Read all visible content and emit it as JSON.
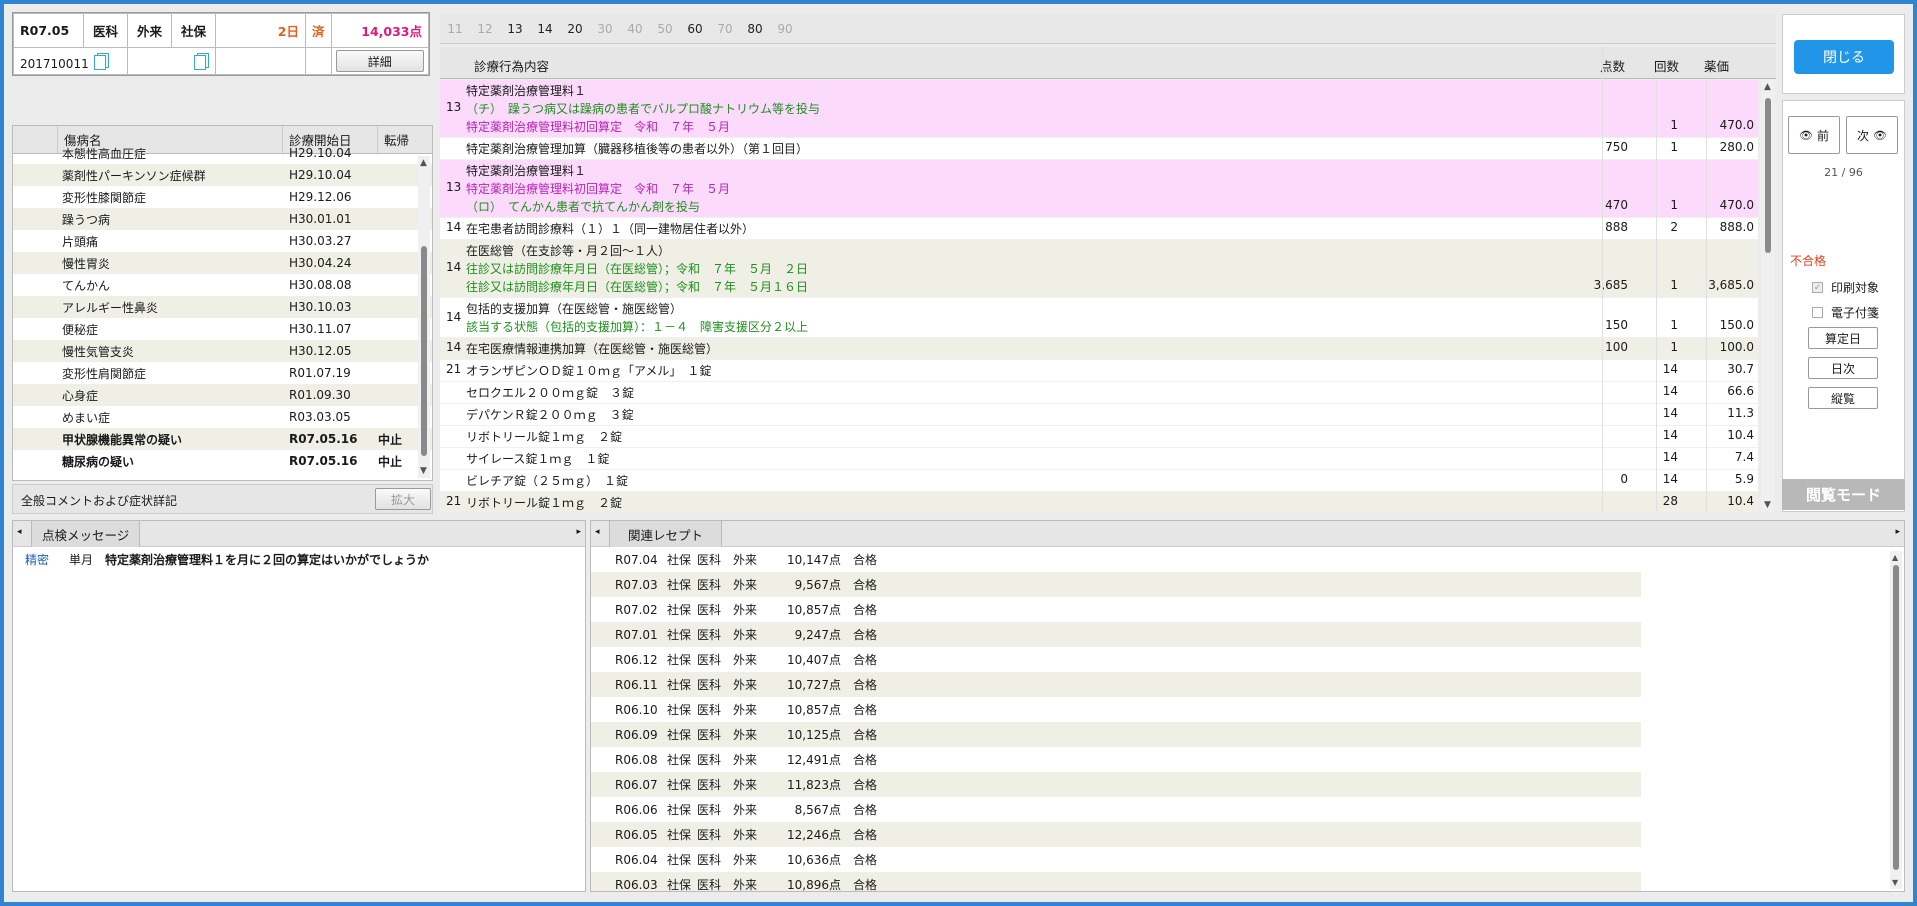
{
  "header": {
    "date": "R07.05",
    "dept": "医科",
    "visit": "外来",
    "insurance": "社保",
    "days": "2日",
    "done": "済",
    "points": "14,033点",
    "patient_id": "201710011",
    "detail_btn": "詳細"
  },
  "disease": {
    "headers": [
      "傷病名",
      "診療開始日",
      "転帰"
    ],
    "rows": [
      {
        "name": "本態性高血圧症",
        "date": "H29.10.04",
        "out": ""
      },
      {
        "name": "薬剤性パーキンソン症候群",
        "date": "H29.10.04",
        "out": ""
      },
      {
        "name": "変形性膝関節症",
        "date": "H29.12.06",
        "out": ""
      },
      {
        "name": "躁うつ病",
        "date": "H30.01.01",
        "out": ""
      },
      {
        "name": "片頭痛",
        "date": "H30.03.27",
        "out": ""
      },
      {
        "name": "慢性胃炎",
        "date": "H30.04.24",
        "out": ""
      },
      {
        "name": "てんかん",
        "date": "H30.08.08",
        "out": ""
      },
      {
        "name": "アレルギー性鼻炎",
        "date": "H30.10.03",
        "out": ""
      },
      {
        "name": "便秘症",
        "date": "H30.11.07",
        "out": ""
      },
      {
        "name": "慢性気管支炎",
        "date": "H30.12.05",
        "out": ""
      },
      {
        "name": "変形性肩関節症",
        "date": "R01.07.19",
        "out": ""
      },
      {
        "name": "心身症",
        "date": "R01.09.30",
        "out": ""
      },
      {
        "name": "めまい症",
        "date": "R03.03.05",
        "out": ""
      },
      {
        "name": "甲状腺機能異常の疑い",
        "date": "R07.05.16",
        "out": "中止"
      },
      {
        "name": "糖尿病の疑い",
        "date": "R07.05.16",
        "out": "中止"
      }
    ]
  },
  "comment": {
    "label": "全般コメントおよび症状詳記",
    "expand_btn": "拡大"
  },
  "tabs": [
    "11",
    "12",
    "13",
    "14",
    "20",
    "30",
    "40",
    "50",
    "60",
    "70",
    "80",
    "90"
  ],
  "main": {
    "headers": {
      "content": "診療行為内容",
      "points": "点数",
      "count": "回数",
      "price": "薬価"
    },
    "rows": [
      {
        "code": "13",
        "style": "pink",
        "lines": [
          {
            "t": "特定薬剤治療管理料１",
            "c": ""
          },
          {
            "t": "（チ）　躁うつ病又は躁病の患者でバルプロ酸ナトリウム等を投与",
            "c": "green"
          },
          {
            "t": "特定薬剤治療管理料初回算定　令和　７年　５月",
            "c": "mag"
          }
        ],
        "points": "",
        "count": "1",
        "price": "470.0"
      },
      {
        "code": "",
        "style": "",
        "lines": [
          {
            "t": "特定薬剤治療管理加算（臓器移植後等の患者以外）（第１回目）",
            "c": ""
          }
        ],
        "points": "750",
        "count": "1",
        "price": "280.0"
      },
      {
        "code": "13",
        "style": "pink",
        "lines": [
          {
            "t": "特定薬剤治療管理料１",
            "c": ""
          },
          {
            "t": "特定薬剤治療管理料初回算定　令和　７年　５月",
            "c": "mag"
          },
          {
            "t": "（ロ）　てんかん患者で抗てんかん剤を投与",
            "c": "green"
          }
        ],
        "points": "470",
        "count": "1",
        "price": "470.0"
      },
      {
        "code": "14",
        "style": "",
        "lines": [
          {
            "t": "在宅患者訪問診療料（１）１（同一建物居住者以外）",
            "c": ""
          }
        ],
        "points": "888",
        "count": "2",
        "price": "888.0"
      },
      {
        "code": "14",
        "style": "beige",
        "lines": [
          {
            "t": "在医総管（在支診等・月２回〜１人）",
            "c": ""
          },
          {
            "t": "往診又は訪問診療年月日（在医総管）；令和　７年　５月　２日",
            "c": "green"
          },
          {
            "t": "往診又は訪問診療年月日（在医総管）；令和　７年　５月１６日",
            "c": "green"
          }
        ],
        "points": "3,685",
        "count": "1",
        "price": "3,685.0"
      },
      {
        "code": "14",
        "style": "",
        "lines": [
          {
            "t": "包括的支援加算（在医総管・施医総管）",
            "c": ""
          },
          {
            "t": "該当する状態（包括的支援加算）：１－４　障害支援区分２以上",
            "c": "green"
          }
        ],
        "points": "150",
        "count": "1",
        "price": "150.0"
      },
      {
        "code": "14",
        "style": "beige",
        "lines": [
          {
            "t": "在宅医療情報連携加算（在医総管・施医総管）",
            "c": ""
          }
        ],
        "points": "100",
        "count": "1",
        "price": "100.0"
      },
      {
        "code": "21",
        "style": "",
        "lines": [
          {
            "t": "オランザピンＯＤ錠１０ｍｇ「アメル」　１錠",
            "c": ""
          }
        ],
        "points": "",
        "count": "14",
        "price": "30.7"
      },
      {
        "code": "",
        "style": "",
        "lines": [
          {
            "t": "セロクエル２００ｍｇ錠　３錠",
            "c": ""
          }
        ],
        "points": "",
        "count": "14",
        "price": "66.6"
      },
      {
        "code": "",
        "style": "",
        "lines": [
          {
            "t": "デパケンＲ錠２００ｍｇ　３錠",
            "c": ""
          }
        ],
        "points": "",
        "count": "14",
        "price": "11.3"
      },
      {
        "code": "",
        "style": "",
        "lines": [
          {
            "t": "リボトリール錠１ｍｇ　２錠",
            "c": ""
          }
        ],
        "points": "",
        "count": "14",
        "price": "10.4"
      },
      {
        "code": "",
        "style": "",
        "lines": [
          {
            "t": "サイレース錠１ｍｇ　１錠",
            "c": ""
          }
        ],
        "points": "",
        "count": "14",
        "price": "7.4"
      },
      {
        "code": "",
        "style": "",
        "lines": [
          {
            "t": "ビレチア錠（２５ｍｇ）　１錠",
            "c": ""
          }
        ],
        "points": "0",
        "count": "14",
        "price": "5.9"
      },
      {
        "code": "21",
        "style": "beige",
        "lines": [
          {
            "t": "リボトリール錠１ｍｇ　２錠",
            "c": ""
          }
        ],
        "points": "",
        "count": "28",
        "price": "10.4"
      }
    ]
  },
  "right": {
    "close": "閉じる",
    "prev": "前",
    "next": "次",
    "page": "21 / 96",
    "status": "不合格",
    "print": "印刷対象",
    "esign": "電子付箋",
    "calc_day": "算定日",
    "daily": "日次",
    "overview": "縦覧",
    "mode": "閲覧モード"
  },
  "check": {
    "tab": "点検メッセージ",
    "level": "精密",
    "period": "単月",
    "message": "特定薬剤治療管理料１を月に２回の算定はいかがでしょうか"
  },
  "related": {
    "tab": "関連レセプト",
    "rows": [
      [
        "R07.04",
        "社保",
        "医科",
        "外来",
        "10,147点",
        "合格"
      ],
      [
        "R07.03",
        "社保",
        "医科",
        "外来",
        "9,567点",
        "合格"
      ],
      [
        "R07.02",
        "社保",
        "医科",
        "外来",
        "10,857点",
        "合格"
      ],
      [
        "R07.01",
        "社保",
        "医科",
        "外来",
        "9,247点",
        "合格"
      ],
      [
        "R06.12",
        "社保",
        "医科",
        "外来",
        "10,407点",
        "合格"
      ],
      [
        "R06.11",
        "社保",
        "医科",
        "外来",
        "10,727点",
        "合格"
      ],
      [
        "R06.10",
        "社保",
        "医科",
        "外来",
        "10,857点",
        "合格"
      ],
      [
        "R06.09",
        "社保",
        "医科",
        "外来",
        "10,125点",
        "合格"
      ],
      [
        "R06.08",
        "社保",
        "医科",
        "外来",
        "12,491点",
        "合格"
      ],
      [
        "R06.07",
        "社保",
        "医科",
        "外来",
        "11,823点",
        "合格"
      ],
      [
        "R06.06",
        "社保",
        "医科",
        "外来",
        "8,567点",
        "合格"
      ],
      [
        "R06.05",
        "社保",
        "医科",
        "外来",
        "12,246点",
        "合格"
      ],
      [
        "R06.04",
        "社保",
        "医科",
        "外来",
        "10,636点",
        "合格"
      ],
      [
        "R06.03",
        "社保",
        "医科",
        "外来",
        "10,896点",
        "合格"
      ]
    ]
  }
}
